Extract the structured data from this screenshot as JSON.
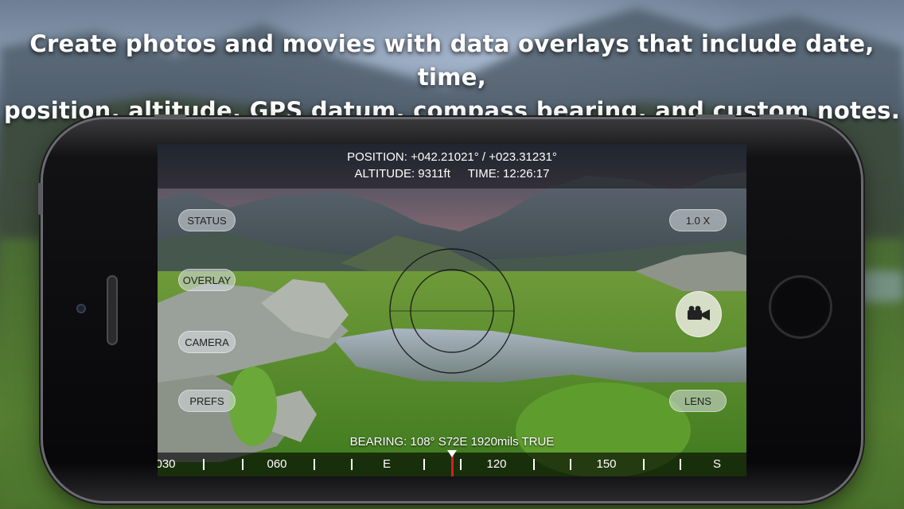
{
  "headline": {
    "line1": "Create photos and movies with data overlays that include date, time,",
    "line2": "position, altitude, GPS datum, compass bearing, and custom notes."
  },
  "overlay": {
    "position": "POSITION: +042.21021° / +023.31231°",
    "altitude": "ALTITUDE: 9311ft",
    "time": "TIME: 12:26:17",
    "bearing": "BEARING: 108° S72E  1920mils  TRUE"
  },
  "buttons": {
    "status": "STATUS",
    "overlay": "OVERLAY",
    "camera": "CAMERA",
    "prefs": "PREFS",
    "zoom": "1.0 X",
    "lens": "LENS"
  },
  "compass": {
    "labels": [
      "030",
      "060",
      "E",
      "120",
      "150",
      "S"
    ],
    "heading_degrees": 108,
    "label_color": "#ffffff",
    "needle_color": "#d42020"
  },
  "icons": {
    "record": "video-camera-icon"
  }
}
